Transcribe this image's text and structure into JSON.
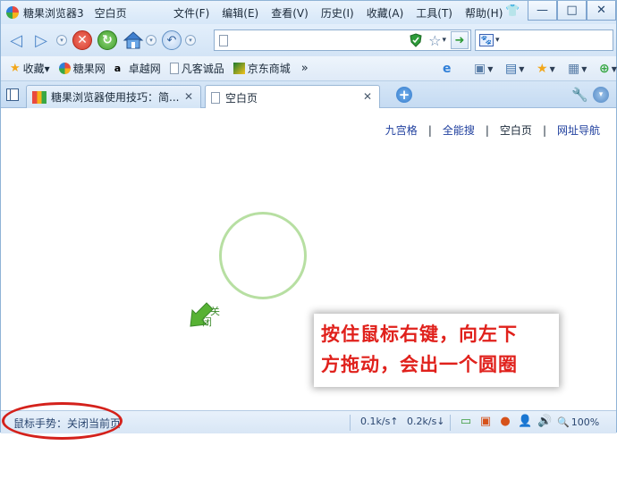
{
  "titlebar": {
    "app_title": "糖果浏览器3",
    "page_title": "空白页",
    "menus": [
      "文件(F)",
      "编辑(E)",
      "查看(V)",
      "历史(I)",
      "收藏(A)",
      "工具(T)",
      "帮助(H)"
    ],
    "minimize": "—",
    "maximize": "□",
    "close": "✕"
  },
  "nav": {
    "back": "◁",
    "forward": "▷",
    "dropdown": "▾",
    "stop": "✕",
    "refresh": "↻",
    "undo": "↶",
    "address_value": "",
    "address_dd": "▾",
    "go": "➜",
    "search_dd": "▾"
  },
  "bookmarks": {
    "favorites": "收藏▾",
    "items": [
      "糖果网",
      "卓越网",
      "凡客诚品",
      "京东商城"
    ],
    "more": "»"
  },
  "tabs": [
    {
      "label": "糖果浏览器使用技巧：简...",
      "close": "✕"
    },
    {
      "label": "空白页",
      "close": "✕"
    }
  ],
  "tabbar": {
    "new_tab": "+",
    "tab_list": "▾"
  },
  "content": {
    "quicklinks": [
      "九宫格",
      "全能搜",
      "空白页",
      "网址导航"
    ],
    "separator": "|",
    "gesture_label_a": "关",
    "gesture_label_b": "闭",
    "annotation_line1": "按住鼠标右键，向左下",
    "annotation_line2": "方拖动，会出一个圆圈"
  },
  "status": {
    "gesture_status": "鼠标手势：关闭当前页",
    "down_speed": "0.1k/s↑",
    "up_speed": "0.2k/s↓",
    "zoom": "100%"
  },
  "colors": {
    "annotation_text": "#e0211c",
    "circle_stroke": "#b7dfa2",
    "link": "#1f3f9e"
  }
}
